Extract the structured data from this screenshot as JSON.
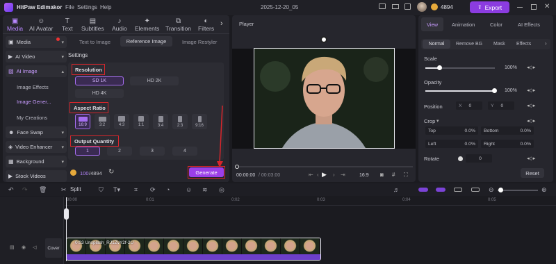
{
  "app": {
    "title": "HitPaw Edimakor",
    "date_label": "2025-12-20_05"
  },
  "menu": [
    "File",
    "Settings",
    "Help"
  ],
  "credits": "4894",
  "export_label": "Export",
  "toolbar": {
    "tabs": [
      "Media",
      "AI Avatar",
      "Text",
      "Subtitles",
      "Audio",
      "Elements",
      "Transition",
      "Filters"
    ]
  },
  "sidebar": {
    "items": [
      {
        "label": "Media"
      },
      {
        "label": "AI Video"
      },
      {
        "label": "AI Image"
      }
    ],
    "sub_items": [
      "Image Effects",
      "Image Gener...",
      "My Creations"
    ],
    "items2": [
      {
        "label": "Face Swap"
      },
      {
        "label": "Video Enhancer"
      },
      {
        "label": "Background"
      },
      {
        "label": "Stock Videos"
      }
    ]
  },
  "ai_image": {
    "modes": [
      "Text to Image",
      "Reference Image",
      "Image Restyler"
    ],
    "settings_title": "Settings",
    "resolution_title": "Resolution",
    "resolutions": [
      "SD 1K",
      "HD 2K",
      "HD 4K"
    ],
    "aspect_title": "Aspect Ratio",
    "ratios": [
      "16:9",
      "3:2",
      "4:3",
      "1:1",
      "3:4",
      "2:3",
      "9:16"
    ],
    "quantity_title": "Output Quantity",
    "quantities": [
      "1",
      "2",
      "3",
      "4"
    ],
    "credits_used": "100",
    "credits_total": "/4894",
    "generate_label": "Generate"
  },
  "player": {
    "title": "Player",
    "time_current": "00:00:00",
    "time_total": "/ 00:03:00",
    "ratio_label": "16:9"
  },
  "right_panel": {
    "tabs": [
      "View",
      "Animation",
      "Color",
      "AI Effects"
    ],
    "subtabs": [
      "Normal",
      "Remove BG",
      "Mask",
      "Effects"
    ],
    "scale_label": "Scale",
    "scale_value": "100%",
    "opacity_label": "Opacity",
    "opacity_value": "100%",
    "position_label": "Position",
    "pos_x_label": "X",
    "pos_x": "0",
    "pos_y_label": "Y",
    "pos_y": "0",
    "crop_label": "Crop",
    "crop_top_label": "Top",
    "crop_top": "0.0%",
    "crop_bottom_label": "Bottom",
    "crop_bottom": "0.0%",
    "crop_left_label": "Left",
    "crop_left": "0.0%",
    "crop_right_label": "Right",
    "crop_right": "0.0%",
    "rotate_label": "Rotate",
    "rotate_value": "0",
    "reset_label": "Reset"
  },
  "timeline": {
    "split_label": "Split",
    "ruler": [
      "00:00",
      "0:01",
      "0:02",
      "0:03",
      "0:04",
      "0:05"
    ],
    "cover_label": "Cover",
    "clip_label": "0:03 Unsplash_RJ1ZvY2f-2U"
  },
  "colors": {
    "accent": "#a56df0",
    "export": "#8b3ce0",
    "annotation": "#d8262c"
  }
}
